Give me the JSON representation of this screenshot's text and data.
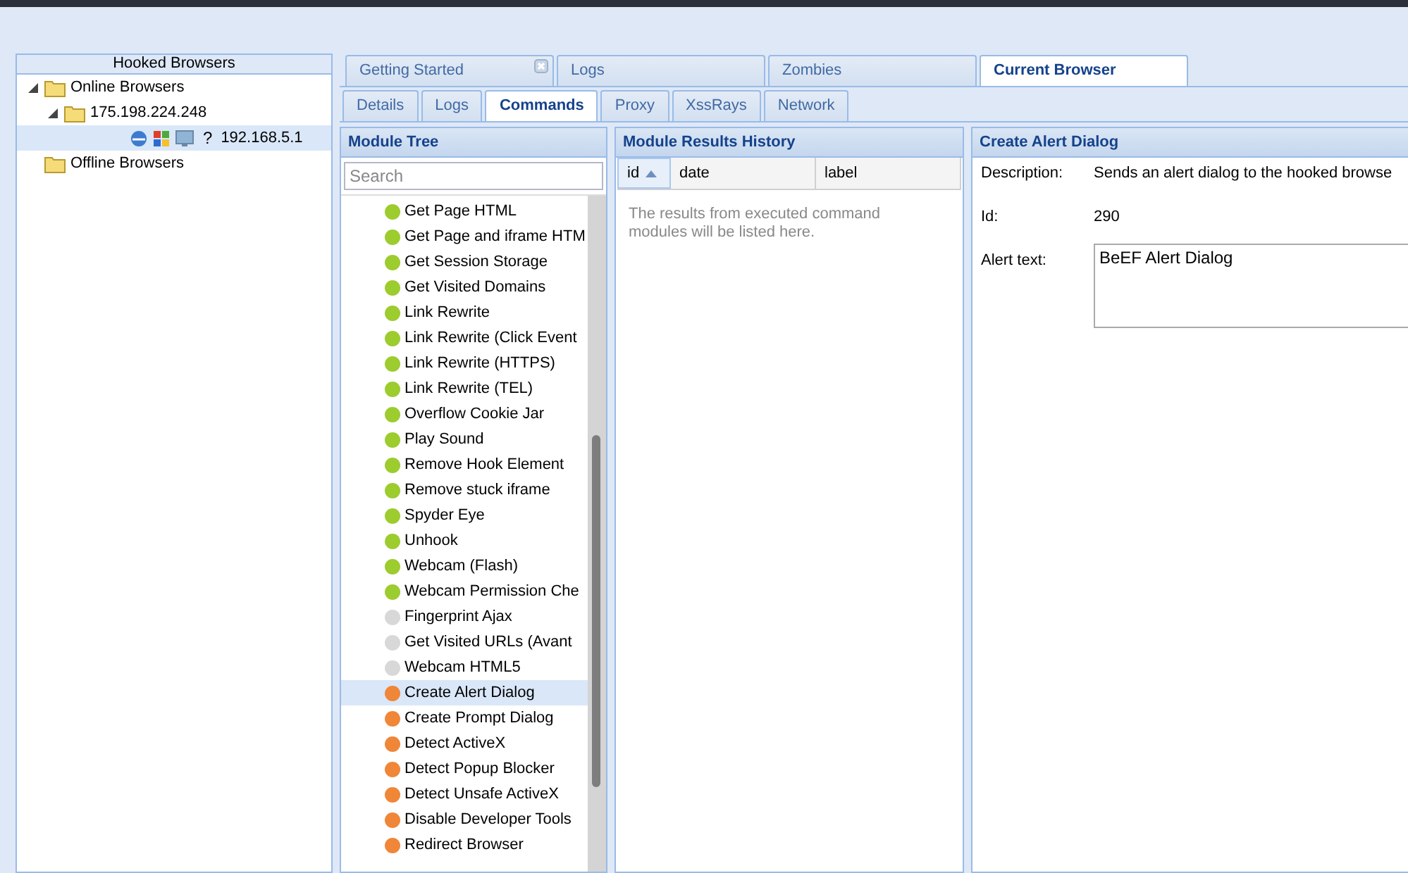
{
  "hooked_browsers": {
    "title": "Hooked Browsers",
    "tree": [
      {
        "label": "Online Browsers",
        "expanded": true,
        "selected": false,
        "children": [
          {
            "label": "175.198.224.248",
            "expanded": true,
            "selected": false,
            "children": [
              {
                "label": "192.168.5.1",
                "kind": "browser",
                "os_mark": "?",
                "selected": true
              }
            ]
          }
        ]
      },
      {
        "label": "Offline Browsers",
        "selected": false
      }
    ]
  },
  "main_tabs": [
    {
      "label": "Getting Started",
      "closable": true,
      "selected": false
    },
    {
      "label": "Logs",
      "closable": false,
      "selected": false
    },
    {
      "label": "Zombies",
      "closable": false,
      "selected": false
    },
    {
      "label": "Current Browser",
      "closable": false,
      "selected": true
    }
  ],
  "sub_tabs": [
    {
      "label": "Details",
      "selected": false
    },
    {
      "label": "Logs",
      "selected": false
    },
    {
      "label": "Commands",
      "selected": true
    },
    {
      "label": "Proxy",
      "selected": false
    },
    {
      "label": "XssRays",
      "selected": false
    },
    {
      "label": "Network",
      "selected": false
    }
  ],
  "module_tree": {
    "title": "Module Tree",
    "search": {
      "placeholder": "Search"
    },
    "items": [
      {
        "label": "Get Page HTML",
        "color": "#9ccc2e",
        "selected": false
      },
      {
        "label": "Get Page and iframe HTM",
        "color": "#9ccc2e",
        "selected": false
      },
      {
        "label": "Get Session Storage",
        "color": "#9ccc2e",
        "selected": false
      },
      {
        "label": "Get Visited Domains",
        "color": "#9ccc2e",
        "selected": false
      },
      {
        "label": "Link Rewrite",
        "color": "#9ccc2e",
        "selected": false
      },
      {
        "label": "Link Rewrite (Click Event",
        "color": "#9ccc2e",
        "selected": false
      },
      {
        "label": "Link Rewrite (HTTPS)",
        "color": "#9ccc2e",
        "selected": false
      },
      {
        "label": "Link Rewrite (TEL)",
        "color": "#9ccc2e",
        "selected": false
      },
      {
        "label": "Overflow Cookie Jar",
        "color": "#9ccc2e",
        "selected": false
      },
      {
        "label": "Play Sound",
        "color": "#9ccc2e",
        "selected": false
      },
      {
        "label": "Remove Hook Element",
        "color": "#9ccc2e",
        "selected": false
      },
      {
        "label": "Remove stuck iframe",
        "color": "#9ccc2e",
        "selected": false
      },
      {
        "label": "Spyder Eye",
        "color": "#9ccc2e",
        "selected": false
      },
      {
        "label": "Unhook",
        "color": "#9ccc2e",
        "selected": false
      },
      {
        "label": "Webcam (Flash)",
        "color": "#9ccc2e",
        "selected": false
      },
      {
        "label": "Webcam Permission Che",
        "color": "#9ccc2e",
        "selected": false
      },
      {
        "label": "Fingerprint Ajax",
        "color": "#d8d8d8",
        "selected": false
      },
      {
        "label": "Get Visited URLs (Avant",
        "color": "#d8d8d8",
        "selected": false
      },
      {
        "label": "Webcam HTML5",
        "color": "#d8d8d8",
        "selected": false
      },
      {
        "label": "Create Alert Dialog",
        "color": "#f08638",
        "selected": true
      },
      {
        "label": "Create Prompt Dialog",
        "color": "#f08638",
        "selected": false
      },
      {
        "label": "Detect ActiveX",
        "color": "#f08638",
        "selected": false
      },
      {
        "label": "Detect Popup Blocker",
        "color": "#f08638",
        "selected": false
      },
      {
        "label": "Detect Unsafe ActiveX",
        "color": "#f08638",
        "selected": false
      },
      {
        "label": "Disable Developer Tools",
        "color": "#f08638",
        "selected": false
      },
      {
        "label": "Redirect Browser",
        "color": "#f08638",
        "selected": false
      }
    ]
  },
  "results": {
    "title": "Module Results History",
    "columns": [
      {
        "label": "id",
        "sorted": true
      },
      {
        "label": "date",
        "sorted": false
      },
      {
        "label": "label",
        "sorted": false
      }
    ],
    "empty_text": "The results from executed command modules will be listed here."
  },
  "module_detail": {
    "title": "Create Alert Dialog",
    "fields": [
      {
        "kind": "text",
        "label": "Description:",
        "value": "Sends an alert dialog to the hooked browse"
      },
      {
        "kind": "text",
        "label": "Id:",
        "value": "290"
      },
      {
        "kind": "textarea",
        "label": "Alert text:",
        "value": "BeEF Alert Dialog"
      }
    ]
  }
}
